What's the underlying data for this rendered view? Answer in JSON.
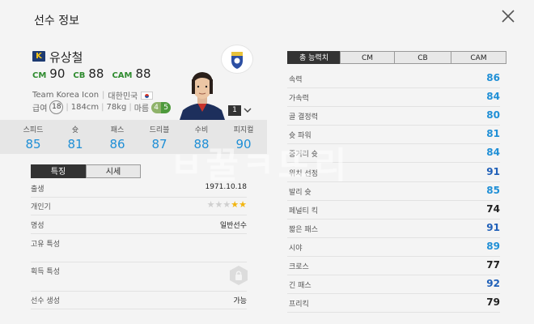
{
  "header": {
    "title": "선수 정보"
  },
  "player": {
    "season_badge": "K",
    "name": "유상철",
    "positions": [
      {
        "label": "CM",
        "value": "90"
      },
      {
        "label": "CB",
        "value": "88"
      },
      {
        "label": "CAM",
        "value": "88"
      }
    ],
    "team": "Team Korea Icon",
    "nation": "대한민국",
    "pay_label": "급여",
    "pay": "18",
    "height": "184cm",
    "weight": "78kg",
    "body_type": "마름",
    "foot_left": "4",
    "foot_right": "5",
    "level": "1"
  },
  "summary_stats": [
    {
      "label": "스피드",
      "value": "85",
      "color": "#1f8fd6"
    },
    {
      "label": "슛",
      "value": "81",
      "color": "#1f8fd6"
    },
    {
      "label": "패스",
      "value": "86",
      "color": "#1f8fd6"
    },
    {
      "label": "드리블",
      "value": "87",
      "color": "#1f8fd6"
    },
    {
      "label": "수비",
      "value": "88",
      "color": "#1f8fd6"
    },
    {
      "label": "피지컬",
      "value": "90",
      "color": "#1f8fd6"
    }
  ],
  "left_tabs": [
    "특징",
    "시세"
  ],
  "details": {
    "birth_label": "출생",
    "birth": "1971.10.18",
    "popularity_label": "개인기",
    "popularity_stars": 2,
    "popularity_max": 5,
    "fame_label": "명성",
    "fame": "일반선수",
    "unique_trait_label": "고유 특성",
    "acquired_trait_label": "획득 특성",
    "player_creation_label": "선수 생성",
    "player_creation": "가능"
  },
  "right_tabs": [
    "총 능력치",
    "CM",
    "CB",
    "CAM"
  ],
  "attributes": [
    {
      "label": "속력",
      "value": "86",
      "color": "#1f8fd6"
    },
    {
      "label": "가속력",
      "value": "84",
      "color": "#1f8fd6"
    },
    {
      "label": "골 결정력",
      "value": "80",
      "color": "#1f8fd6"
    },
    {
      "label": "슛 파워",
      "value": "81",
      "color": "#1f8fd6"
    },
    {
      "label": "중거리 슛",
      "value": "84",
      "color": "#1f8fd6"
    },
    {
      "label": "위치 선정",
      "value": "91",
      "color": "#1f5fb8"
    },
    {
      "label": "발리 슛",
      "value": "85",
      "color": "#1f8fd6"
    },
    {
      "label": "페널티 킥",
      "value": "74",
      "color": "#222222"
    },
    {
      "label": "짧은 패스",
      "value": "91",
      "color": "#1f5fb8"
    },
    {
      "label": "시야",
      "value": "89",
      "color": "#1f8fd6"
    },
    {
      "label": "크로스",
      "value": "77",
      "color": "#222222"
    },
    {
      "label": "긴 패스",
      "value": "92",
      "color": "#1f5fb8"
    },
    {
      "label": "프리킥",
      "value": "79",
      "color": "#222222"
    }
  ],
  "colors": {
    "accent_blue": "#1f8fd6",
    "dark_blue": "#1f5fb8",
    "position_green": "#2e8b2e"
  }
}
